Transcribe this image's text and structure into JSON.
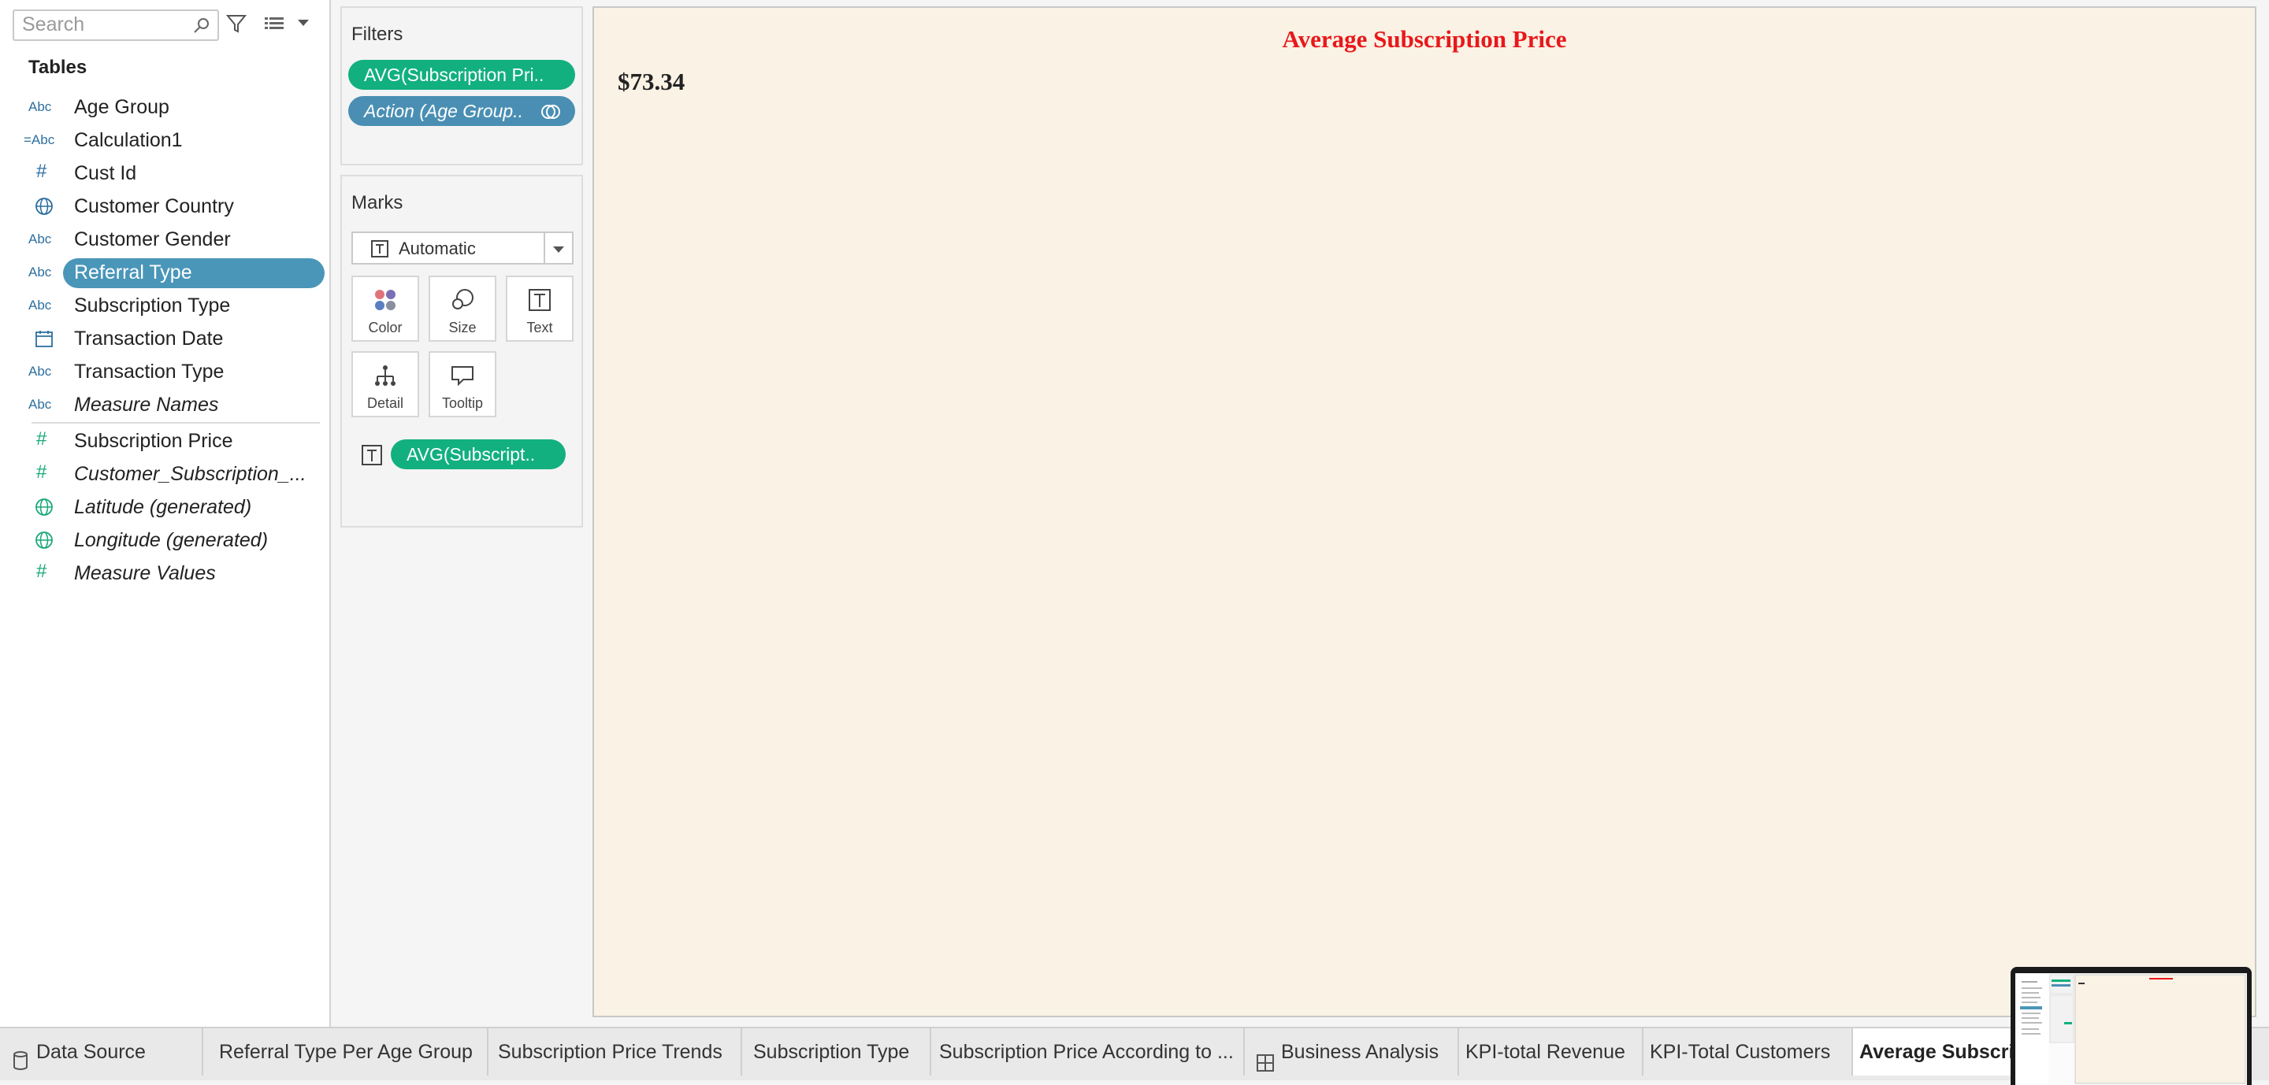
{
  "search": {
    "placeholder": "Search"
  },
  "data_pane": {
    "tables_label": "Tables",
    "fields": [
      {
        "type_label": "Abc",
        "name": "Age Group"
      },
      {
        "type_label": "=Abc",
        "name": "Calculation1"
      },
      {
        "type_label": "#",
        "name": "Cust Id"
      },
      {
        "type_label": "globe",
        "name": "Customer Country"
      },
      {
        "type_label": "Abc",
        "name": "Customer Gender"
      },
      {
        "type_label": "Abc",
        "name": "Referral Type"
      },
      {
        "type_label": "Abc",
        "name": "Subscription Type"
      },
      {
        "type_label": "calendar",
        "name": "Transaction Date"
      },
      {
        "type_label": "Abc",
        "name": "Transaction Type"
      },
      {
        "type_label": "Abc",
        "name": "Measure Names"
      }
    ],
    "measures": [
      {
        "type_label": "#",
        "name": "Subscription Price"
      },
      {
        "type_label": "#",
        "name": "Customer_Subscription_..."
      },
      {
        "type_label": "globe",
        "name": "Latitude (generated)"
      },
      {
        "type_label": "globe",
        "name": "Longitude (generated)"
      },
      {
        "type_label": "#",
        "name": "Measure Values"
      }
    ],
    "selected_field": "Referral Type"
  },
  "filters": {
    "title": "Filters",
    "pills": [
      "AVG(Subscription Pri..",
      "Action (Age Group.."
    ]
  },
  "marks": {
    "title": "Marks",
    "mark_type": "Automatic",
    "buttons": [
      "Color",
      "Size",
      "Text",
      "Detail",
      "Tooltip"
    ],
    "text_pill": "AVG(Subscript.."
  },
  "view": {
    "title": "Average Subscription Price",
    "value": "$73.34"
  },
  "tabs": [
    {
      "label": "Data Source"
    },
    {
      "label": "Referral Type Per Age Group"
    },
    {
      "label": "Subscription Price Trends"
    },
    {
      "label": "Subscription Type"
    },
    {
      "label": "Subscription Price According to ..."
    },
    {
      "label": "Business Analysis"
    },
    {
      "label": "KPI-total Revenue"
    },
    {
      "label": "KPI-Total Customers"
    },
    {
      "label": "Average Subscri"
    }
  ],
  "colors": {
    "title_red": "#e8181b",
    "measure_pill_green": "#12b07f",
    "dimension_pill_blue": "#4a8fb3",
    "view_background": "#f9f2e5"
  }
}
